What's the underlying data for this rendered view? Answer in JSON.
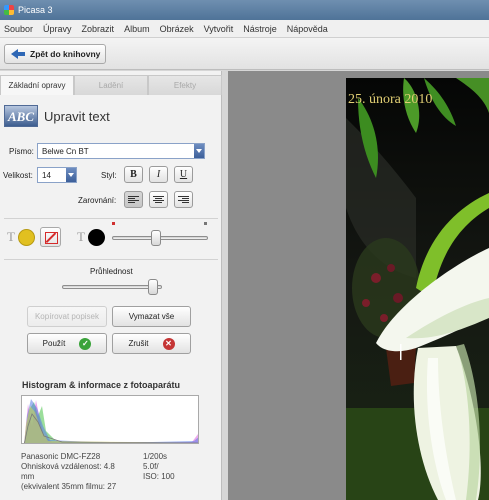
{
  "window": {
    "title": "Picasa 3"
  },
  "menu": [
    "Soubor",
    "Úpravy",
    "Zobrazit",
    "Album",
    "Obrázek",
    "Vytvořit",
    "Nástroje",
    "Nápověda"
  ],
  "toolbar": {
    "back_label": "Zpět do knihovny"
  },
  "tabs": [
    "Základní opravy",
    "Ladění",
    "Efekty"
  ],
  "edit": {
    "title": "Upravit text",
    "abc_logo": "ABC",
    "font_label": "Písmo:",
    "font_value": "Belwe Cn BT",
    "size_label": "Velikost:",
    "size_value": "14",
    "style_label": "Styl:",
    "bold": "B",
    "italic": "I",
    "underline": "U",
    "align_label": "Zarovnání:",
    "text_color_glyph": "T",
    "transparency_label": "Průhlednost",
    "transparency_fraction": 0.96,
    "outline_slider_fraction": 0.45
  },
  "buttons": {
    "copy_label": "Kopírovat popisek",
    "clear_label": "Vymazat vše",
    "apply_label": "Použít",
    "cancel_label": "Zrušit"
  },
  "histogram": {
    "title": "Histogram & informace z fotoaparátu",
    "camera": "Panasonic DMC-FZ28",
    "focal_label": "Ohnisková vzdálenost: 4.8",
    "focal_unit": "mm",
    "equiv": "(ekvivalent 35mm filmu:  27",
    "shutter": "1/200s",
    "aperture": "5.0f/",
    "iso": "ISO: 100"
  },
  "photo": {
    "caption": "25. února 2010"
  },
  "colors": {
    "accent": "#2e67b5",
    "text_fill": "#e1c020",
    "outline": "#000000",
    "caption": "#e2cf74"
  }
}
